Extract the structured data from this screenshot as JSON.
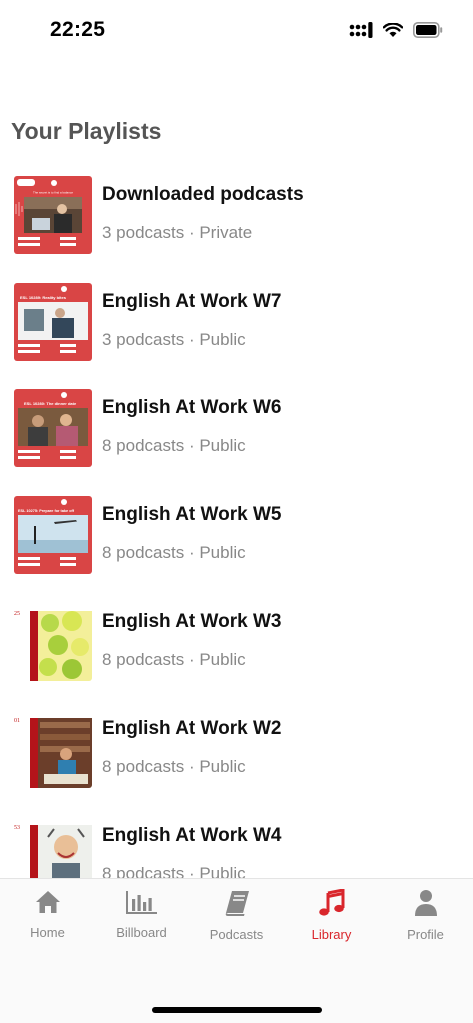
{
  "status": {
    "time": "22:25"
  },
  "library": {
    "title": "Your Playlists"
  },
  "playlists": [
    {
      "title": "Downloaded podcasts",
      "subtitle": "3 podcasts · Private"
    },
    {
      "title": "English At Work W7",
      "subtitle": "3 podcasts · Public"
    },
    {
      "title": "English At Work W6",
      "subtitle": "8 podcasts · Public"
    },
    {
      "title": "English At Work W5",
      "subtitle": "8 podcasts · Public"
    },
    {
      "title": "English At Work W3",
      "subtitle": "8 podcasts · Public"
    },
    {
      "title": "English At Work W2",
      "subtitle": "8 podcasts · Public"
    },
    {
      "title": "English At Work W4",
      "subtitle": "8 podcasts · Public"
    }
  ],
  "thumbs": {
    "t1_caption": "The secret is to find a balance",
    "t2_caption": "ESL 10289: Reality bites",
    "t3_caption": "ESL 10280: The dinner date",
    "t4_caption": "ESL 10275: Prepare for take off",
    "t5_num": "25",
    "t6_num": "01",
    "t7_num": "53"
  },
  "tabs": [
    {
      "label": "Home",
      "icon": "home-icon"
    },
    {
      "label": "Billboard",
      "icon": "chart-icon"
    },
    {
      "label": "Podcasts",
      "icon": "book-icon"
    },
    {
      "label": "Library",
      "icon": "music-note-icon"
    },
    {
      "label": "Profile",
      "icon": "person-icon"
    }
  ],
  "colors": {
    "accent": "#d9262c",
    "thumb_red": "#d94545",
    "muted": "#888888"
  }
}
